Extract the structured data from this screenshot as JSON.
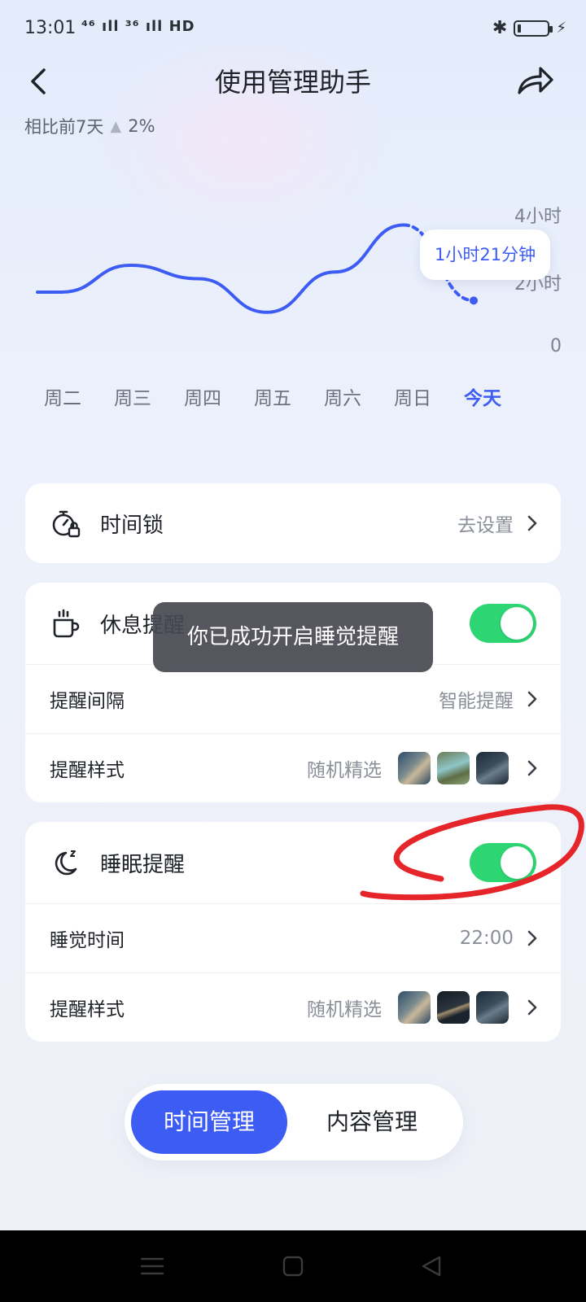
{
  "status_bar": {
    "time": "13:01",
    "network": "⁴⁶ ıll ³⁶ ıll HD"
  },
  "nav": {
    "title": "使用管理助手"
  },
  "compare": {
    "text": "相比前7天",
    "percent": "2%"
  },
  "chart_data": {
    "type": "line",
    "categories": [
      "周二",
      "周三",
      "周四",
      "周五",
      "周六",
      "周日",
      "今天"
    ],
    "series": [
      {
        "values": [
          1.6,
          2.4,
          2.0,
          1.0,
          2.2,
          3.6,
          1.35
        ]
      }
    ],
    "y_tick_labels": [
      "4小时",
      "2小时",
      "0"
    ],
    "ylim": [
      0,
      4
    ],
    "tooltip": "1小时21分钟",
    "active_category": "今天",
    "line_color": "#3d5cf4"
  },
  "time_lock": {
    "title": "时间锁",
    "value": "去设置"
  },
  "rest_reminder": {
    "title": "休息提醒",
    "enabled": true,
    "rows": [
      {
        "label": "提醒间隔",
        "value": "智能提醒"
      },
      {
        "label": "提醒样式",
        "value": "随机精选"
      }
    ]
  },
  "sleep_reminder": {
    "title": "睡眠提醒",
    "enabled": true,
    "rows": [
      {
        "label": "睡觉时间",
        "value": "22:00"
      },
      {
        "label": "提醒样式",
        "value": "随机精选"
      }
    ]
  },
  "toast": "你已成功开启睡觉提醒",
  "segment": {
    "active": "时间管理",
    "inactive": "内容管理"
  },
  "colors": {
    "accent": "#3d5cf4",
    "toggle_on": "#2ed573",
    "annotation": "#e5252a"
  }
}
